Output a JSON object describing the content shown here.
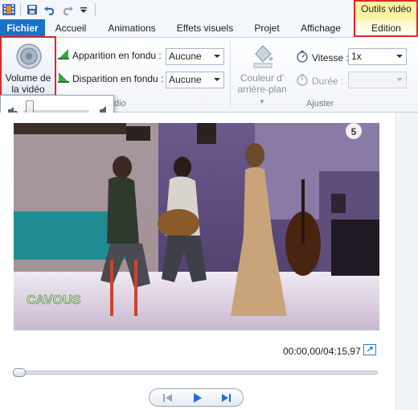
{
  "contextual": {
    "label": "Outils vidéo"
  },
  "tabs": [
    {
      "label": "Fichier"
    },
    {
      "label": "Accueil"
    },
    {
      "label": "Animations"
    },
    {
      "label": "Effets visuels"
    },
    {
      "label": "Projet"
    },
    {
      "label": "Affichage"
    },
    {
      "label": "Edition"
    }
  ],
  "audio_group": {
    "volume_label_line1": "Volume de",
    "volume_label_line2": "la vidéo",
    "fade_in_label": "Apparition en fondu :",
    "fade_in_value": "Aucune",
    "fade_out_label": "Disparition en fondu :",
    "fade_out_value": "Aucune",
    "group_label_partial": "dio"
  },
  "adjust_group": {
    "bg_color_line1": "Couleur d'",
    "bg_color_line2": "arrière-plan",
    "speed_label": "Vitesse :",
    "speed_value": "1x",
    "duration_label": "Durée :",
    "duration_value": "",
    "group_label": "Ajuster"
  },
  "video": {
    "watermark": "CAVOUS",
    "channel_badge": "5"
  },
  "player": {
    "time": "00:00,00/04:15,97"
  },
  "volume": {
    "level": 0.1
  },
  "colors": {
    "accent": "#1b70c9",
    "contextual": "#fbf3a2",
    "highlight": "#e0262a"
  },
  "icons": [
    "app-icon",
    "save-icon",
    "undo-icon",
    "redo-icon",
    "customize-qat-icon",
    "speaker-icon",
    "fade-in-icon",
    "fade-out-icon",
    "paint-bucket-icon",
    "speed-icon",
    "duration-icon",
    "mute-icon",
    "volume-max-icon",
    "fullscreen-icon",
    "previous-frame-icon",
    "play-icon",
    "next-frame-icon"
  ]
}
